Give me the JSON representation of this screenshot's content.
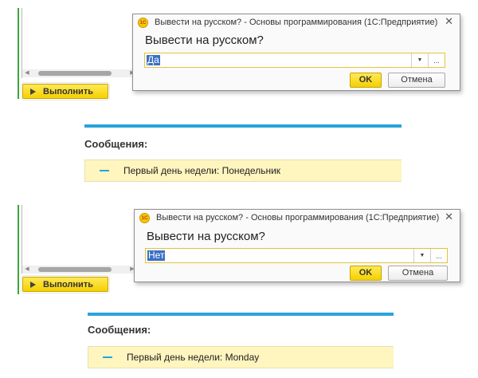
{
  "run_button_label": "Выполнить",
  "dialogs": [
    {
      "title": "Вывести на русском? - Основы программирования  (1С:Предприятие)",
      "question": "Вывести на русском?",
      "value": "Да",
      "ok_label": "OK",
      "cancel_label": "Отмена",
      "icon_text": "1С"
    },
    {
      "title": "Вывести на русском? - Основы программирования  (1С:Предприятие)",
      "question": "Вывести на русском?",
      "value": "Нет",
      "ok_label": "OK",
      "cancel_label": "Отмена",
      "icon_text": "1С"
    }
  ],
  "messages": [
    {
      "header": "Сообщения:",
      "text": "Первый день недели: Понедельник"
    },
    {
      "header": "Сообщения:",
      "text": "Первый день недели: Monday"
    }
  ],
  "glyphs": {
    "close": "✕",
    "dropdown": "▼",
    "more": "...",
    "scroll_left": "◀",
    "scroll_right": "▶"
  },
  "colors": {
    "accent_yellow": "#f5d000",
    "messages_bar": "#2aa4db",
    "selection": "#3b6fc5",
    "message_bg": "#fff5bf"
  }
}
